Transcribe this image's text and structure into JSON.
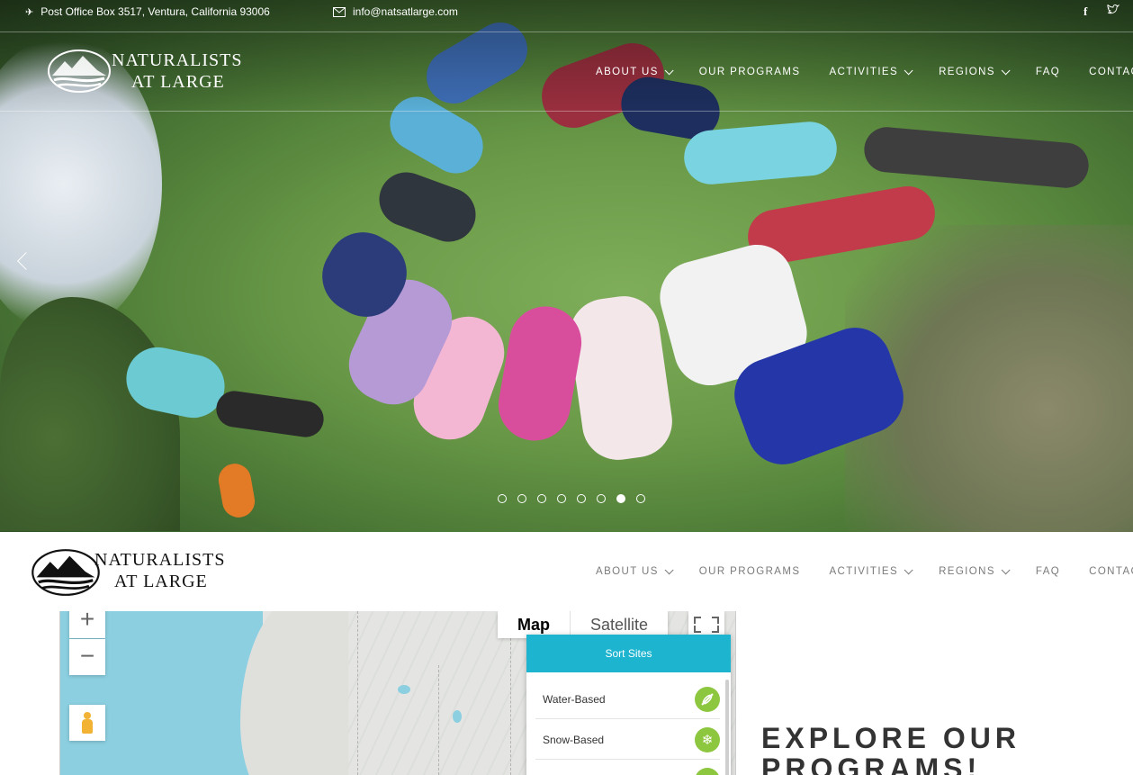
{
  "brand": {
    "line1": "NATURALISTS",
    "line2": "AT LARGE"
  },
  "topbar": {
    "address": "Post Office Box 3517, Ventura, California 93006",
    "email": "info@natsatlarge.com",
    "social": {
      "facebook": "f",
      "twitter": "t"
    }
  },
  "nav": {
    "items": [
      {
        "label": "ABOUT US",
        "dropdown": true
      },
      {
        "label": "OUR PROGRAMS",
        "dropdown": false
      },
      {
        "label": "ACTIVITIES",
        "dropdown": true
      },
      {
        "label": "REGIONS",
        "dropdown": true
      },
      {
        "label": "FAQ",
        "dropdown": false
      },
      {
        "label": "CONTACT",
        "dropdown": false
      }
    ]
  },
  "slider": {
    "slide_count": 8,
    "active_index": 6
  },
  "map": {
    "zoom_in": "+",
    "zoom_out": "−",
    "type_map": "Map",
    "type_satellite": "Satellite",
    "sort_title": "Sort Sites",
    "sort_items": [
      {
        "label": "Water-Based",
        "icon": "kayak-icon"
      },
      {
        "label": "Snow-Based",
        "icon": "snowflake-icon"
      }
    ]
  },
  "section": {
    "heading_line1": "EXPLORE OUR",
    "heading_line2": "PROGRAMS!"
  },
  "colors": {
    "accent": "#1cb4cf",
    "badge": "#8dc63f",
    "ocean": "#8bcfe0"
  }
}
